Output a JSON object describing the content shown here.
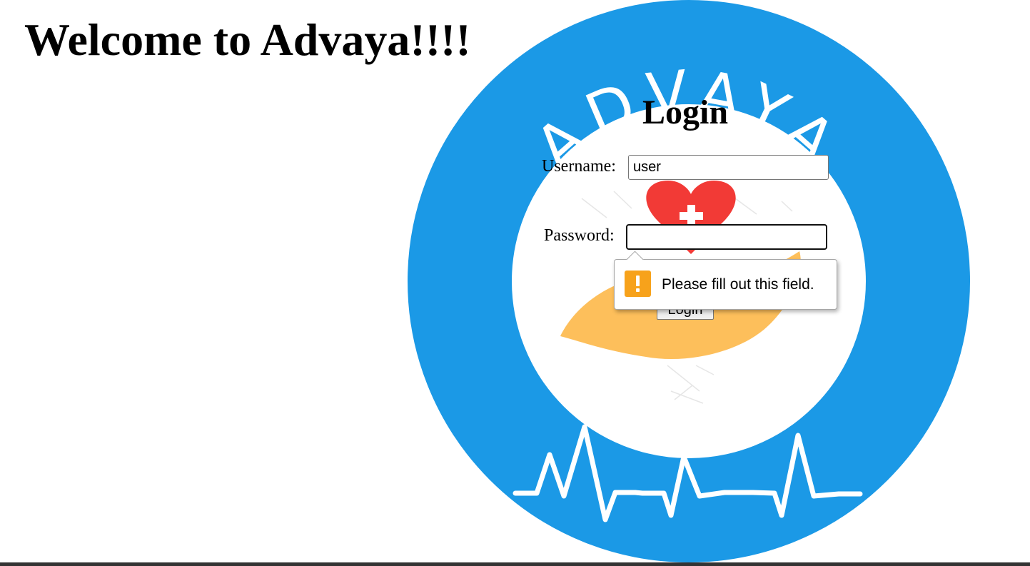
{
  "header": {
    "welcome_text": "Welcome to Advaya!!!!"
  },
  "logo": {
    "wordmark": "ADVAYA",
    "ring_color": "#1b99e6",
    "heart_color": "#f23a36",
    "hand_color": "#fdbf5b"
  },
  "login": {
    "title": "Login",
    "username_label": "Username:",
    "username_value": "user",
    "password_label": "Password:",
    "password_value": "",
    "submit_label": "Login"
  },
  "validation": {
    "message": "Please fill out this field.",
    "icon": "warning-icon",
    "icon_color": "#f7a21b"
  }
}
